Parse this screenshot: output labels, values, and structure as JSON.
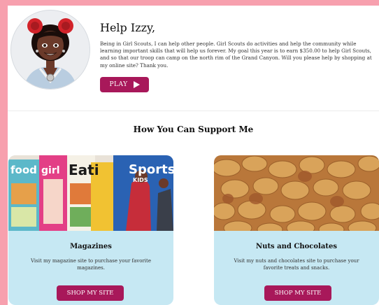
{
  "header": {
    "greeting": "Help Izzy,",
    "message": "Being in Girl Scouts, I can help other people. Girl Scouts do activities and help the community while learning important skills that will help us forever. My goal this year is to earn $350.00 to help Girl Scouts, and so that our troop can camp on the north rim of the Grand Canyon. Will you please help by shopping at my online site? Thank you.",
    "play_label": "PLAY"
  },
  "section": {
    "title": "How You Can Support Me"
  },
  "cards": [
    {
      "title": "Magazines",
      "description": "Visit my magazine site to purchase your favorite magazines.",
      "button_label": "SHOP MY SITE",
      "covers": [
        "food",
        "girl",
        "Eati",
        "Sports",
        "KIDS"
      ]
    },
    {
      "title": "Nuts and Chocolates",
      "description": "Visit my nuts and chocolates site to purchase your favorite treats and snacks.",
      "button_label": "SHOP MY SITE"
    }
  ],
  "colors": {
    "accent": "#a8185a",
    "card_bg": "#c6e8f3",
    "page_border": "#f7a0ae"
  }
}
